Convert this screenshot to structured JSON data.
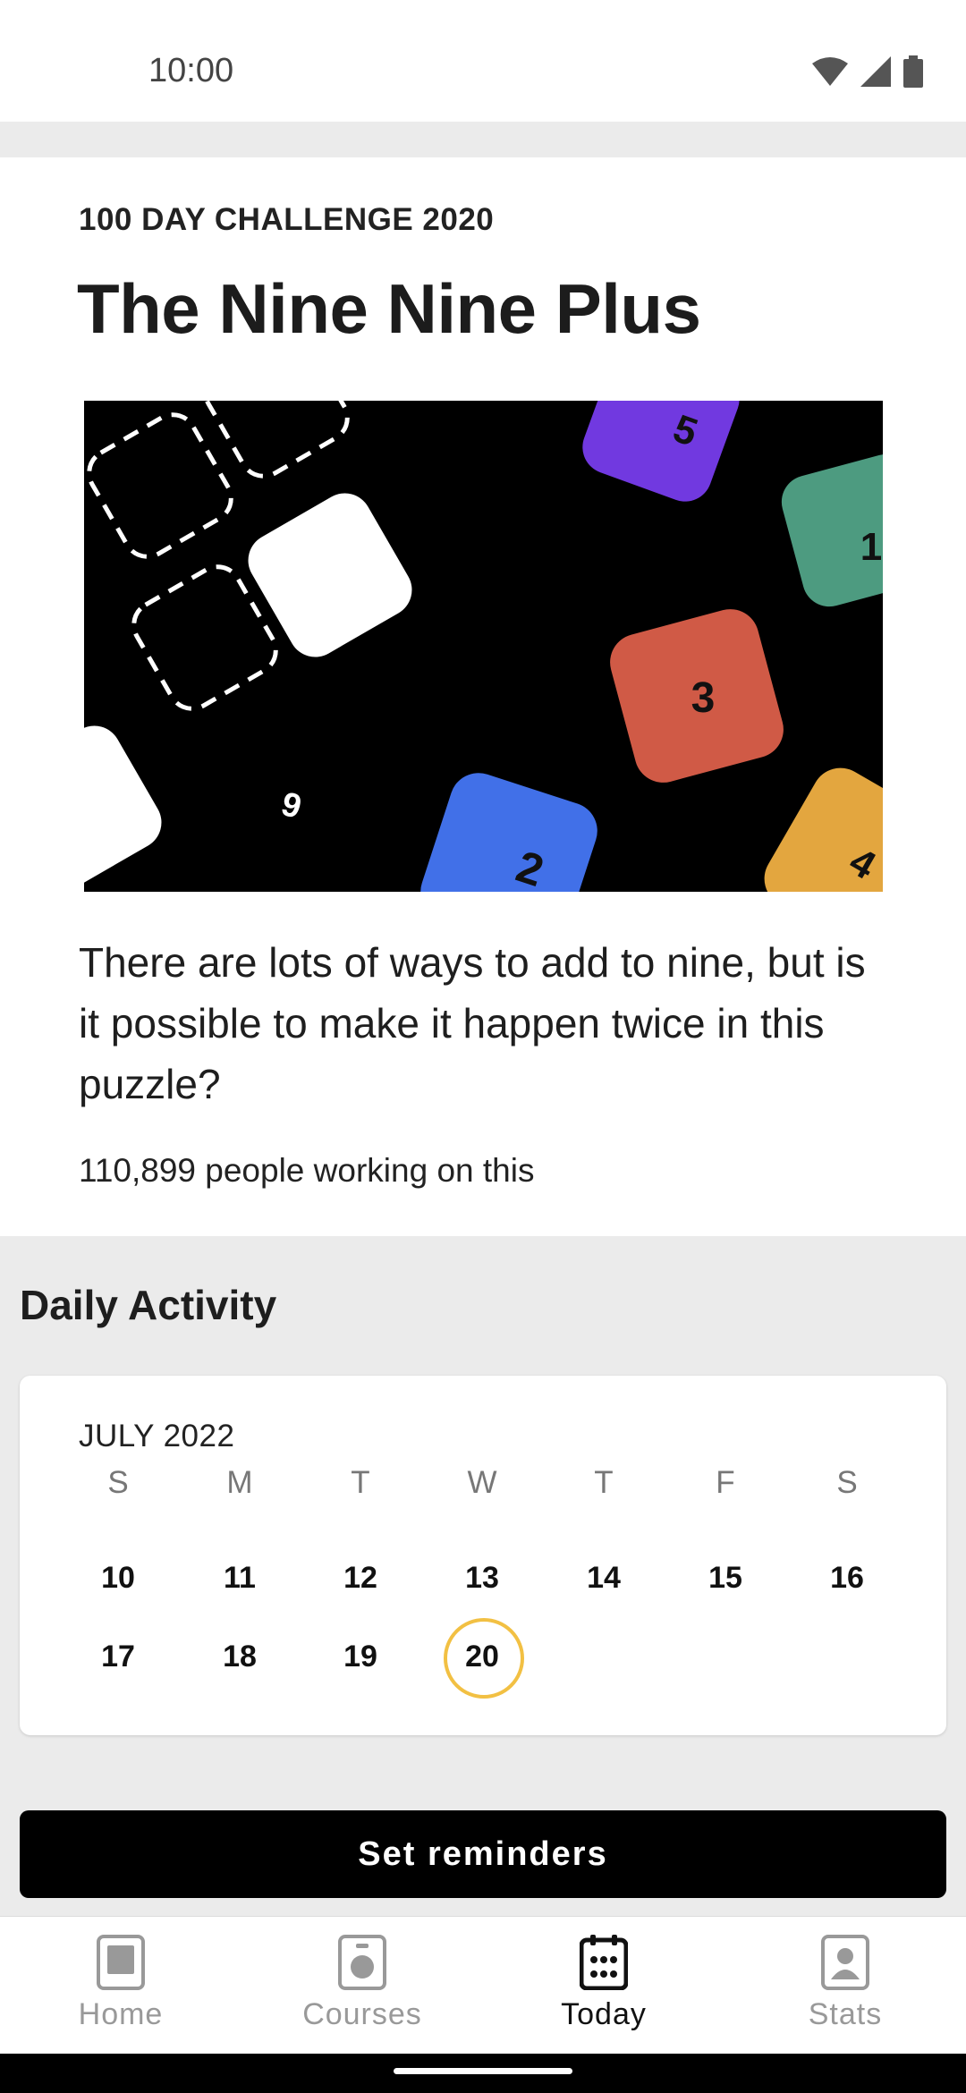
{
  "status_bar": {
    "time": "10:00"
  },
  "challenge": {
    "eyebrow": "100 DAY CHALLENGE 2020",
    "title": "The Nine Nine Plus",
    "hero_tiles": [
      "5",
      "1",
      "3",
      "2",
      "4",
      "9"
    ],
    "description": "There are lots of ways to add to nine, but is it possible to make it happen twice in this puzzle?",
    "working": "110,899 people working on this"
  },
  "daily_activity": {
    "title": "Daily Activity",
    "month": "JULY 2022",
    "weekdays": [
      "S",
      "M",
      "T",
      "W",
      "T",
      "F",
      "S"
    ],
    "weeks": [
      [
        "10",
        "11",
        "12",
        "13",
        "14",
        "15",
        "16"
      ],
      [
        "17",
        "18",
        "19",
        "20"
      ]
    ],
    "today": "20",
    "today_ring_color": "#f2c043"
  },
  "reminder_button": {
    "label": "Set reminders"
  },
  "nav": {
    "home": "Home",
    "courses": "Courses",
    "today": "Today",
    "stats": "Stats",
    "active": "today"
  }
}
